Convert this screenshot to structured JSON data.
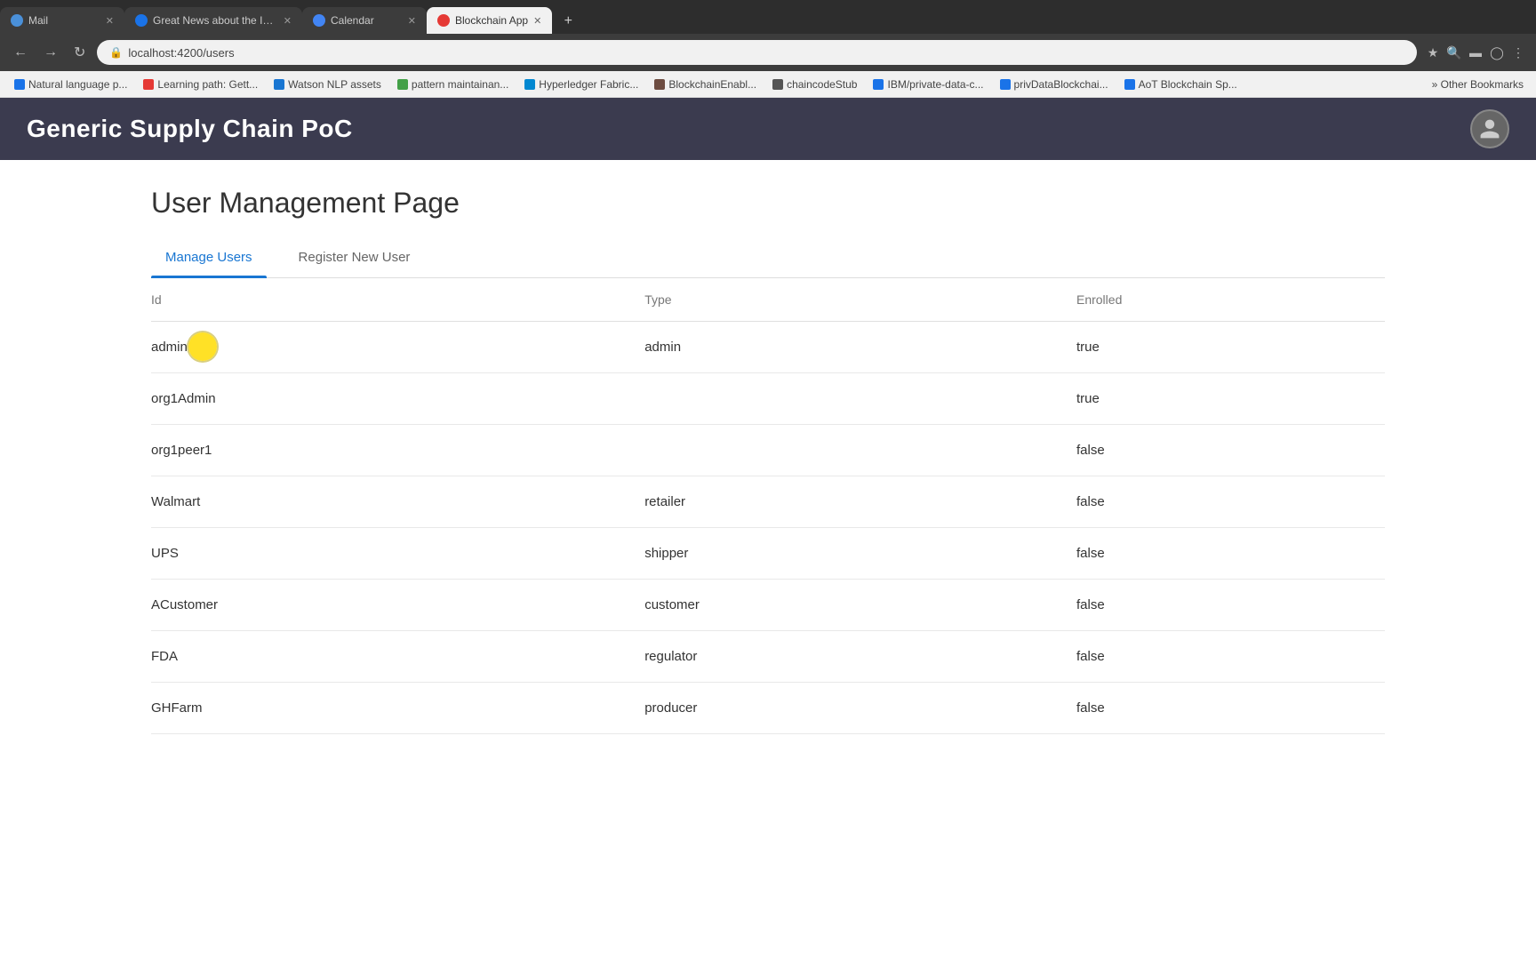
{
  "browser": {
    "tabs": [
      {
        "id": "mail",
        "label": "Mail",
        "icon_color": "#4a90d9",
        "active": false,
        "closeable": true
      },
      {
        "id": "ibm",
        "label": "Great News about the IBM Publ...",
        "icon_color": "#1a73e8",
        "active": false,
        "closeable": true
      },
      {
        "id": "calendar",
        "label": "Calendar",
        "icon_color": "#4285f4",
        "active": false,
        "closeable": true
      },
      {
        "id": "blockchain",
        "label": "Blockchain App",
        "icon_color": "#e53935",
        "active": true,
        "closeable": true
      }
    ],
    "new_tab_icon": "+",
    "address": "localhost:4200/users",
    "bookmarks": [
      {
        "label": "Natural language p...",
        "icon_color": "#1a73e8"
      },
      {
        "label": "Learning path: Gett...",
        "icon_color": "#e53935"
      },
      {
        "label": "Watson NLP assets",
        "icon_color": "#1976d2"
      },
      {
        "label": "pattern maintainan...",
        "icon_color": "#43a047"
      },
      {
        "label": "Hyperledger Fabric...",
        "icon_color": "#0288d1"
      },
      {
        "label": "BlockchainEnabl...",
        "icon_color": "#6d4c41"
      },
      {
        "label": "chaincodeStub",
        "icon_color": "#555"
      },
      {
        "label": "IBM/private-data-c...",
        "icon_color": "#1a73e8"
      },
      {
        "label": "privDataBlockchai...",
        "icon_color": "#1a73e8"
      },
      {
        "label": "AoT Blockchain Sp...",
        "icon_color": "#1a73e8"
      }
    ],
    "bookmarks_more": "» Other Bookmarks"
  },
  "app": {
    "title": "Generic Supply Chain PoC",
    "avatar_icon": "person"
  },
  "page": {
    "title": "User Management Page",
    "tabs": [
      {
        "id": "manage",
        "label": "Manage Users",
        "active": true
      },
      {
        "id": "register",
        "label": "Register New User",
        "active": false
      }
    ],
    "table": {
      "columns": [
        "Id",
        "Type",
        "Enrolled"
      ],
      "rows": [
        {
          "id": "admin",
          "type": "admin",
          "enrolled": "true"
        },
        {
          "id": "org1Admin",
          "type": "",
          "enrolled": "true"
        },
        {
          "id": "org1peer1",
          "type": "",
          "enrolled": "false"
        },
        {
          "id": "Walmart",
          "type": "retailer",
          "enrolled": "false"
        },
        {
          "id": "UPS",
          "type": "shipper",
          "enrolled": "false"
        },
        {
          "id": "ACustomer",
          "type": "customer",
          "enrolled": "false"
        },
        {
          "id": "FDA",
          "type": "regulator",
          "enrolled": "false"
        },
        {
          "id": "GHFarm",
          "type": "producer",
          "enrolled": "false"
        }
      ]
    }
  }
}
